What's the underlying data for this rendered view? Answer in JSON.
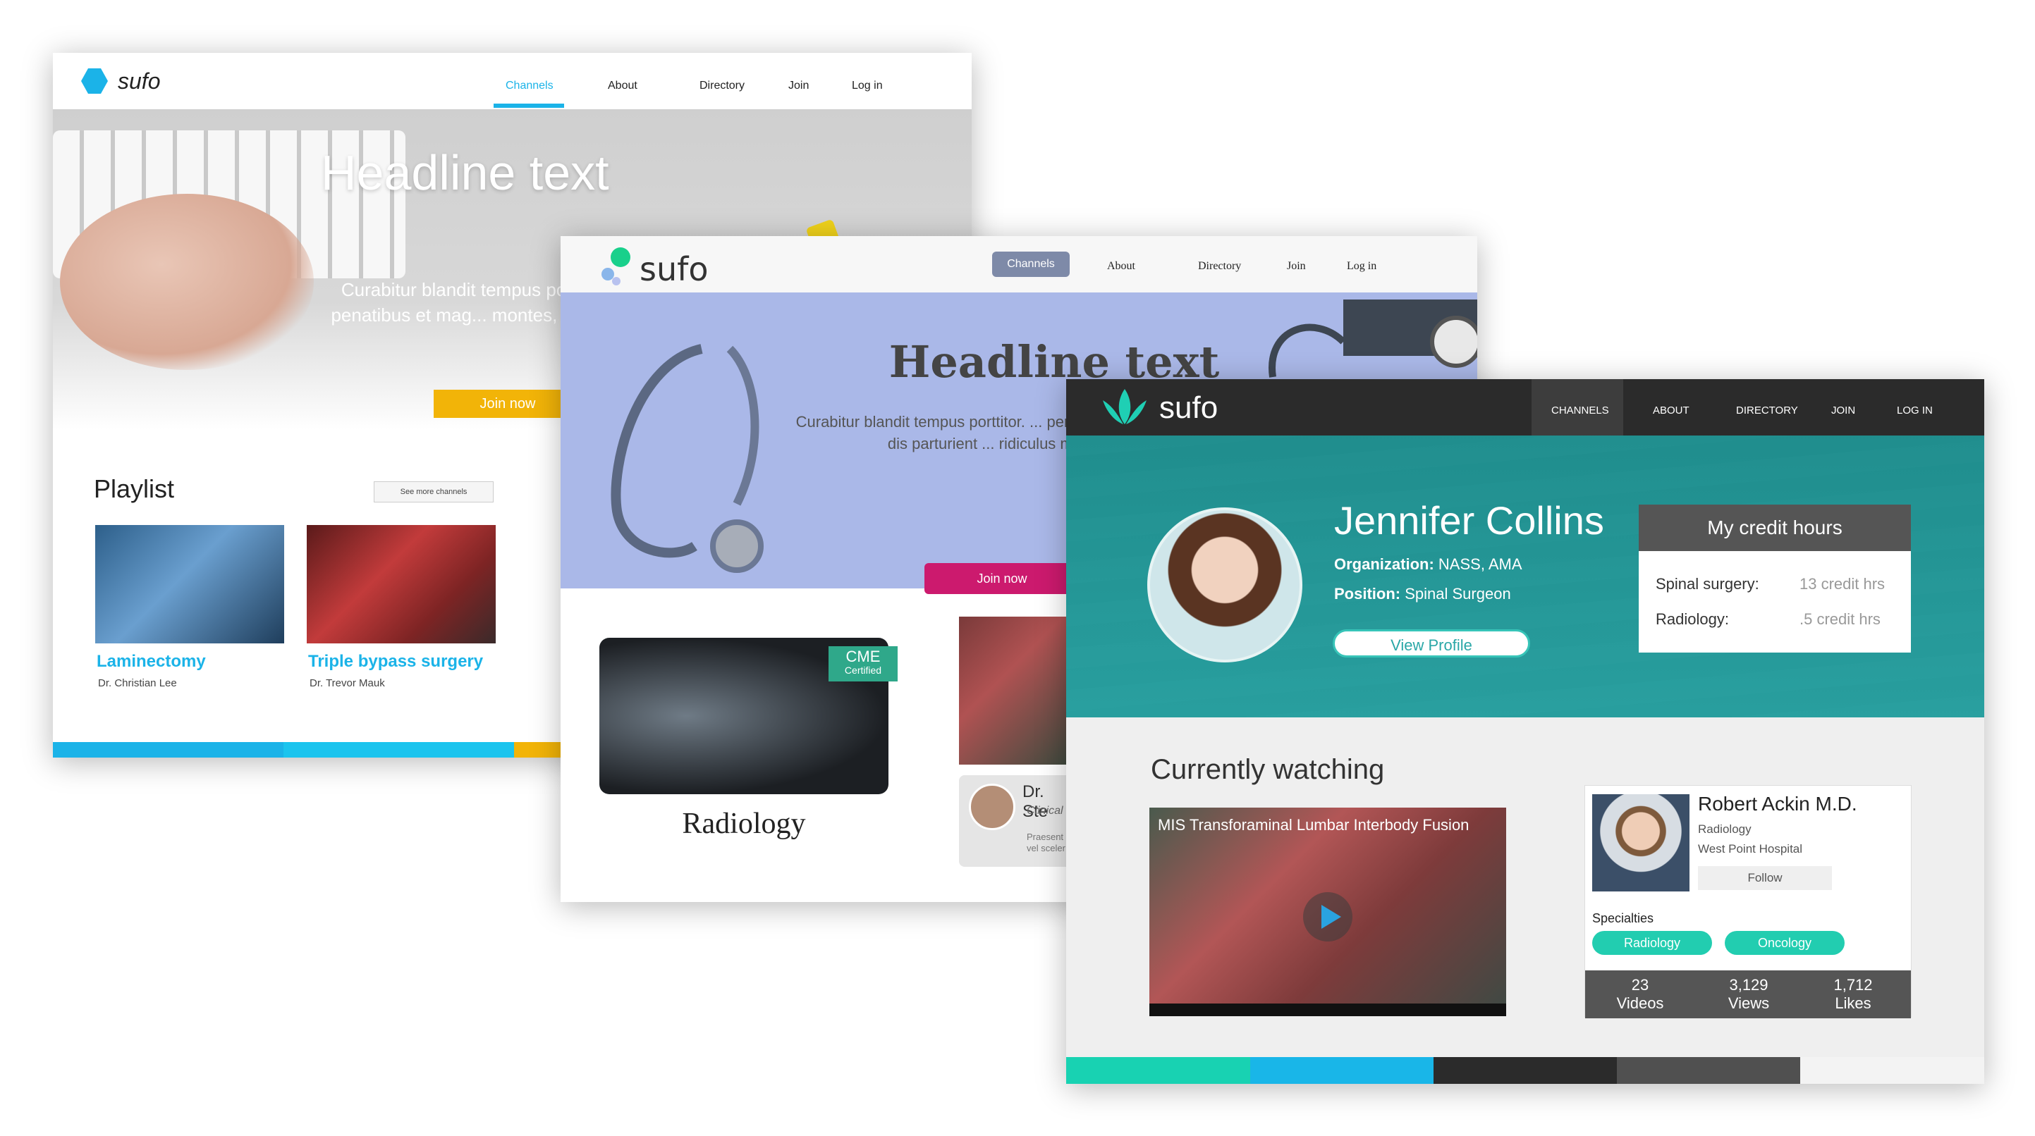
{
  "window1": {
    "logo": "sufo",
    "nav": [
      "Channels",
      "About",
      "Directory",
      "Join",
      "Log in"
    ],
    "headline": "Headline text",
    "hero_text": "Curabitur blandit tempus po... natoque penatibus et mag... montes, nascetur ri...",
    "join_label": "Join now",
    "playlist_title": "Playlist",
    "see_more": "See more channels",
    "videos": [
      {
        "title": "Laminectomy",
        "author": "Dr. Christian Lee"
      },
      {
        "title": "Triple bypass surgery",
        "author": "Dr. Trevor Mauk"
      }
    ],
    "bar_colors": [
      "#1bb3e8",
      "#1bc4ee",
      "#f2b408"
    ]
  },
  "window2": {
    "logo": "sufo",
    "nav": [
      "Channels",
      "About",
      "Directory",
      "Join",
      "Log in"
    ],
    "headline": "Headline text",
    "hero_text": "Curabitur blandit tempus porttitor. ... penatibus et magnis dis parturient ... ridiculus mus.",
    "join_label": "Join now",
    "cme_line1": "CME",
    "cme_line2": "Certified",
    "category": "Radiology",
    "card_name": "Dr. Ste",
    "card_role": "Clinical",
    "card_desc": "Praesent vel sceler"
  },
  "window3": {
    "logo": "sufo",
    "nav": [
      "CHANNELS",
      "ABOUT",
      "DIRECTORY",
      "JOIN",
      "LOG IN"
    ],
    "profile": {
      "name": "Jennifer Collins",
      "org_label": "Organization:",
      "org_value": "NASS, AMA",
      "pos_label": "Position:",
      "pos_value": "Spinal Surgeon",
      "view_profile": "View Profile"
    },
    "credit": {
      "title": "My credit hours",
      "rows": [
        {
          "label": "Spinal surgery:",
          "value": "13 credit hrs"
        },
        {
          "label": "Radiology:",
          "value": ".5 credit hrs"
        }
      ]
    },
    "currently_watching": "Currently watching",
    "video_title": "MIS Transforaminal Lumbar Interbody Fusion",
    "doctor": {
      "name": "Robert Ackin M.D.",
      "department": "Radiology",
      "hospital": "West Point Hospital",
      "follow": "Follow",
      "specialties_label": "Specialties",
      "specialties": [
        "Radiology",
        "Oncology"
      ],
      "stats": [
        {
          "num": "23",
          "label": "Videos"
        },
        {
          "num": "3,129",
          "label": "Views"
        },
        {
          "num": "1,712",
          "label": "Likes"
        }
      ]
    },
    "bar_colors": [
      "#18d2b2",
      "#19b6e8",
      "#2b2b2b",
      "#505050",
      "#f3f3f3"
    ]
  }
}
